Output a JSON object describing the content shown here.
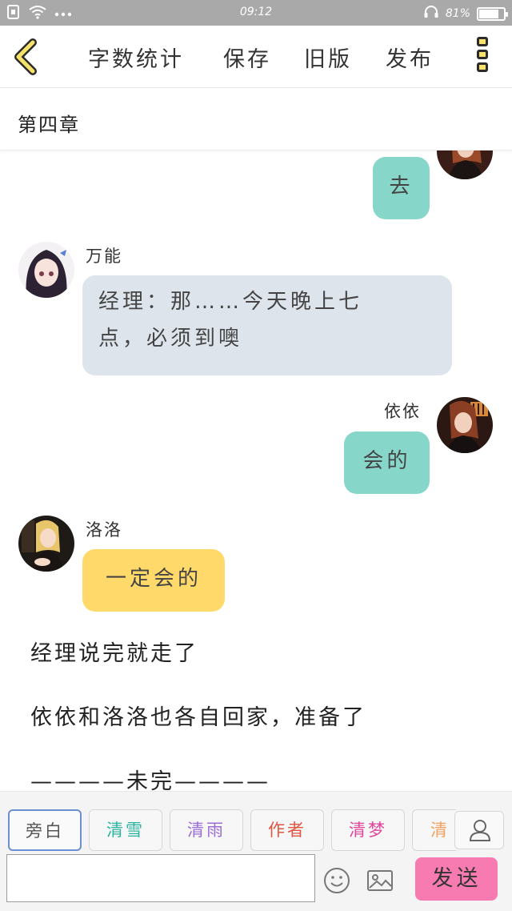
{
  "status_bar": {
    "time": "09:12",
    "battery": "81%",
    "battery_level": 0.81,
    "icons": [
      "sim-icon",
      "wifi-icon",
      "more-dots-icon",
      "headset-icon",
      "battery-icon"
    ]
  },
  "toolbar": {
    "back_icon": "chevron-left-icon",
    "word_count": "字数统计",
    "save": "保存",
    "old_version": "旧版",
    "publish": "发布",
    "more_icon": "more-vertical-icon"
  },
  "chapter": {
    "title": "第四章"
  },
  "messages": [
    {
      "side": "right",
      "speaker": "",
      "text": "去",
      "color": "#86d7ca"
    },
    {
      "side": "left",
      "speaker": "万能",
      "text_line1": "经理：那……今天晚上七",
      "text_line2": "点，必须到噢",
      "color": "#dde4ec"
    },
    {
      "side": "right",
      "speaker": "依依",
      "text": "会的",
      "color": "#86d7ca"
    },
    {
      "side": "left",
      "speaker": "洛洛",
      "text": "一定会的",
      "color": "#ffd96a"
    }
  ],
  "narration": [
    "经理说完就走了",
    "依依和洛洛也各自回家，准备了",
    "————未完————"
  ],
  "roles": [
    {
      "label": "旁白",
      "color": "#555555"
    },
    {
      "label": "清雪",
      "color": "#29b3a0"
    },
    {
      "label": "清雨",
      "color": "#9a6cd4"
    },
    {
      "label": "作者",
      "color": "#e0553f"
    },
    {
      "label": "清梦",
      "color": "#e0459c"
    },
    {
      "label": "清",
      "color": "#f0a060"
    }
  ],
  "composer": {
    "input_value": "",
    "send": "发送",
    "emoji_icon": "smiley-icon",
    "image_icon": "image-icon",
    "user_icon": "user-icon"
  },
  "colors": {
    "accent_send": "#f77bb1",
    "bubble_teal": "#86d7ca",
    "bubble_grey": "#dde4ec",
    "bubble_yellow": "#ffd96a",
    "status_bar": "#a9a9a9"
  }
}
